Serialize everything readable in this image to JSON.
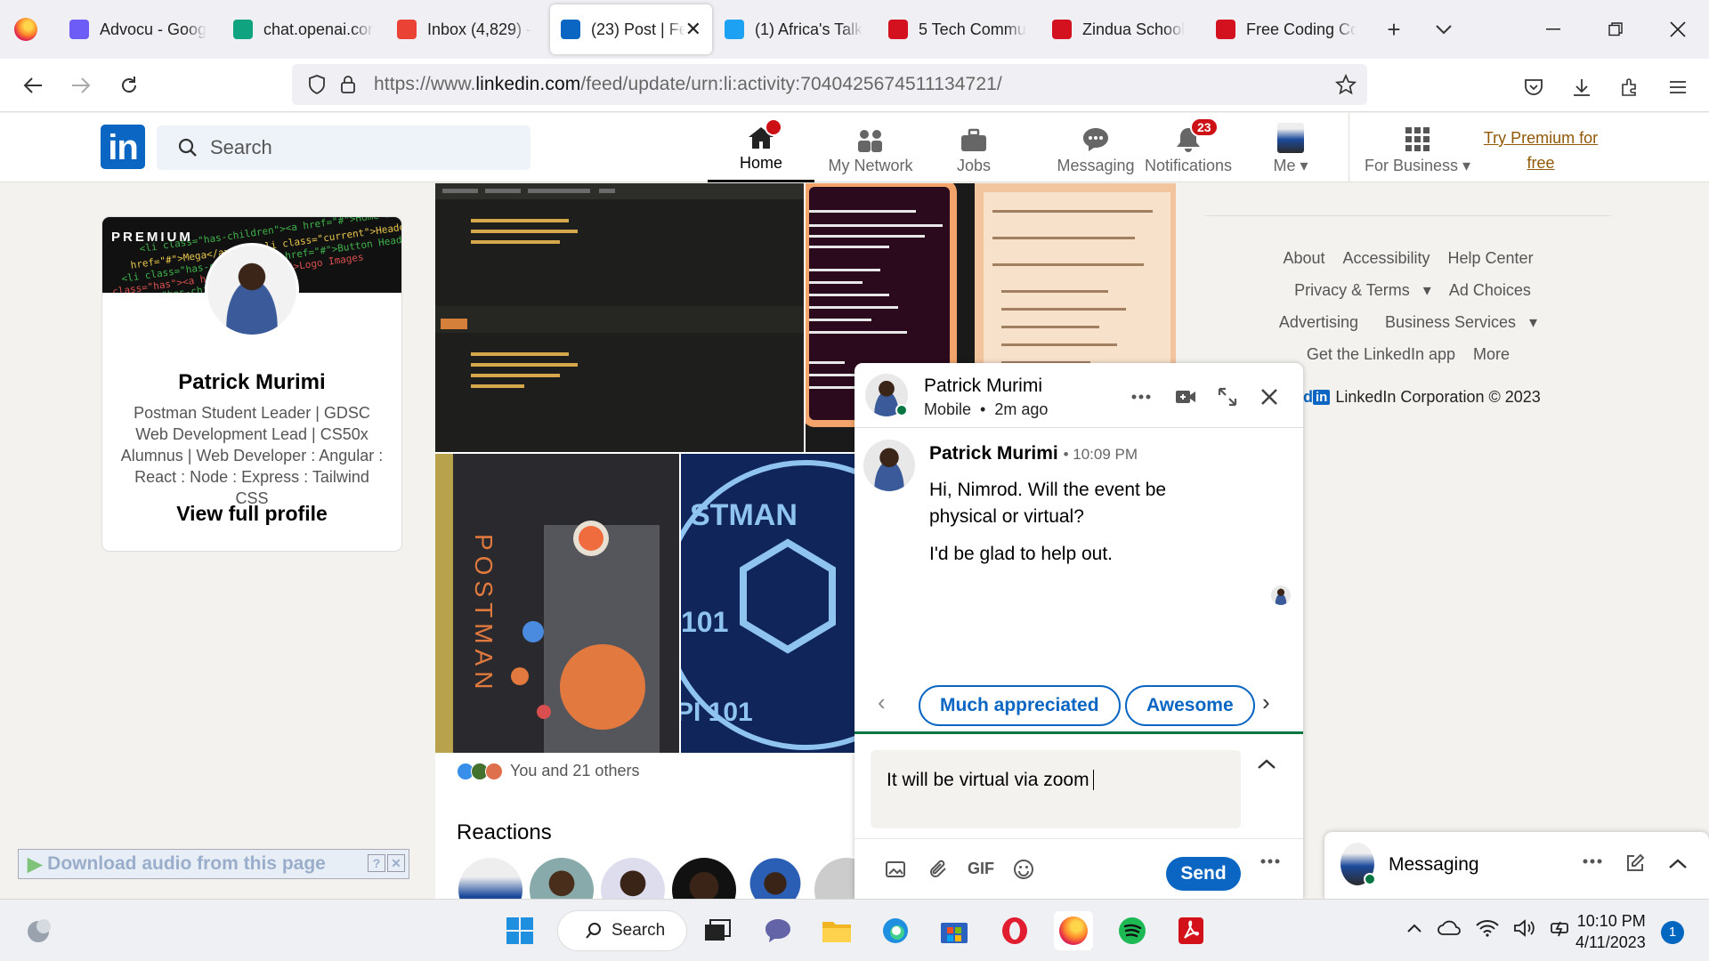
{
  "browser": {
    "tabs": [
      {
        "title": "Advocu - Goog",
        "color": "#6d5cf6"
      },
      {
        "title": "chat.openai.com",
        "color": "#10a37f"
      },
      {
        "title": "Inbox (4,829) -",
        "color": "#ea4335"
      },
      {
        "title": "(23) Post | Feed",
        "color": "#0a66c2",
        "active": true
      },
      {
        "title": "(1) Africa's Talk",
        "color": "#1da1f2"
      },
      {
        "title": "5 Tech Commu",
        "color": "#d4111e"
      },
      {
        "title": "Zindua School",
        "color": "#d4111e"
      },
      {
        "title": "Free Coding Co",
        "color": "#d4111e"
      }
    ],
    "url_prefix": "https://www.",
    "url_domain": "linkedin.com",
    "url_path": "/feed/update/urn:li:activity:7040425674511134721/"
  },
  "linkedin": {
    "logo": "in",
    "search_placeholder": "Search",
    "nav": {
      "home": "Home",
      "network": "My Network",
      "jobs": "Jobs",
      "messaging": "Messaging",
      "notifications": "Notifications",
      "notifications_count": "23",
      "me": "Me",
      "business": "For Business",
      "premium_line1": "Try Premium for",
      "premium_line2": "free"
    },
    "accent": "#0a66c2"
  },
  "profile": {
    "premium_label": "PREMIUM",
    "name": "Patrick Murimi",
    "headline": "Postman Student Leader | GDSC Web Development Lead | CS50x Alumnus | Web Developer : Angular : React : Node : Express : Tailwind CSS",
    "view_profile": "View full profile"
  },
  "post": {
    "reactions_text": "You and 21 others",
    "reactions_title": "Reactions",
    "img3_text": "POSTMAN",
    "img4_text_top": "STMAN",
    "img4_text_bottom": "PI 101",
    "img4_text_mid": "101"
  },
  "footer": {
    "links_row1": [
      "About",
      "Accessibility",
      "Help Center"
    ],
    "links_row2": [
      "Privacy & Terms",
      "Ad Choices"
    ],
    "links_row3": [
      "Advertising",
      "Business Services"
    ],
    "links_row4": [
      "Get the LinkedIn app",
      "More"
    ],
    "copyright": "LinkedIn Corporation © 2023",
    "brand_fragment": "ed"
  },
  "chat": {
    "name": "Patrick Murimi",
    "status_device": "Mobile",
    "status_time": "2m ago",
    "message_author": "Patrick Murimi",
    "message_time": "• 10:09 PM",
    "message_line1": "Hi, Nimrod. Will the event be physical or virtual?",
    "message_line2": "I'd be glad to help out.",
    "replies": [
      "Much appreciated",
      "Awesome"
    ],
    "compose_value": "It will be virtual via zoom",
    "send_label": "Send",
    "gif_label": "GIF"
  },
  "messaging_bar": {
    "label": "Messaging"
  },
  "extension": {
    "download_label": "Download audio from this page"
  },
  "taskbar": {
    "search_label": "Search",
    "time": "10:10 PM",
    "date": "4/11/2023",
    "notification_count": "1"
  }
}
